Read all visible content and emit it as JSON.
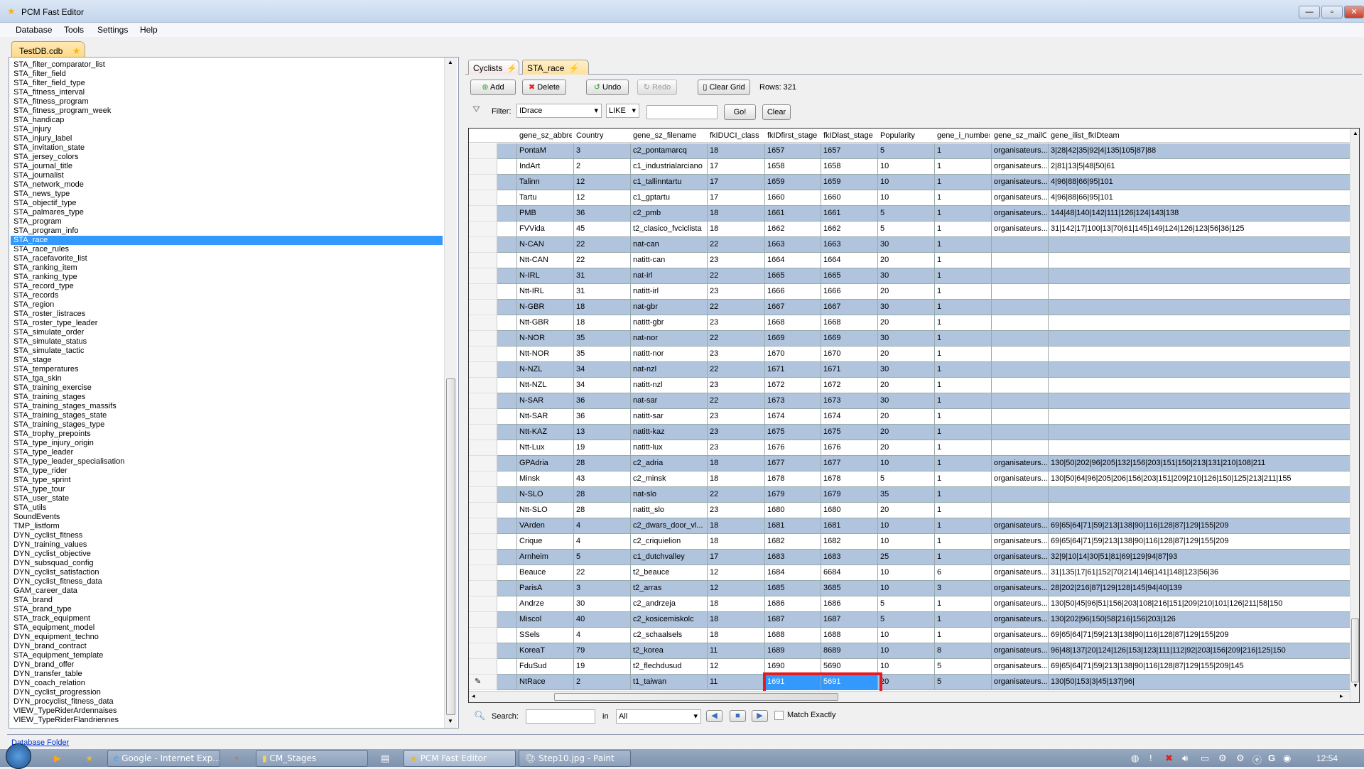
{
  "window": {
    "title": "PCM Fast Editor"
  },
  "menu": [
    "Database",
    "Tools",
    "Settings",
    "Help"
  ],
  "file_tab": "TestDB.cdb",
  "table_list": {
    "selected": "STA_race",
    "items": [
      "STA_filter_comparator_list",
      "STA_filter_field",
      "STA_filter_field_type",
      "STA_fitness_interval",
      "STA_fitness_program",
      "STA_fitness_program_week",
      "STA_handicap",
      "STA_injury",
      "STA_injury_label",
      "STA_invitation_state",
      "STA_jersey_colors",
      "STA_journal_title",
      "STA_journalist",
      "STA_network_mode",
      "STA_news_type",
      "STA_objectif_type",
      "STA_palmares_type",
      "STA_program",
      "STA_program_info",
      "STA_race",
      "STA_race_rules",
      "STA_racefavorite_list",
      "STA_ranking_item",
      "STA_ranking_type",
      "STA_record_type",
      "STA_records",
      "STA_region",
      "STA_roster_listraces",
      "STA_roster_type_leader",
      "STA_simulate_order",
      "STA_simulate_status",
      "STA_simulate_tactic",
      "STA_stage",
      "STA_temperatures",
      "STA_tga_skin",
      "STA_training_exercise",
      "STA_training_stages",
      "STA_training_stages_massifs",
      "STA_training_stages_state",
      "STA_training_stages_type",
      "STA_trophy_prepoints",
      "STA_type_injury_origin",
      "STA_type_leader",
      "STA_type_leader_specialisation",
      "STA_type_rider",
      "STA_type_sprint",
      "STA_type_tour",
      "STA_user_state",
      "STA_utils",
      "SoundEvents",
      "TMP_listform",
      "DYN_cyclist_fitness",
      "DYN_training_values",
      "DYN_cyclist_objective",
      "DYN_subsquad_config",
      "DYN_cyclist_satisfaction",
      "DYN_cyclist_fitness_data",
      "GAM_career_data",
      "STA_brand",
      "STA_brand_type",
      "STA_track_equipment",
      "STA_equipment_model",
      "DYN_equipment_techno",
      "DYN_brand_contract",
      "STA_equipment_template",
      "DYN_brand_offer",
      "DYN_transfer_table",
      "DYN_coach_relation",
      "DYN_cyclist_progression",
      "DYN_procyclist_fitness_data",
      "VIEW_TypeRiderArdennaises",
      "VIEW_TypeRiderFlandriennes"
    ]
  },
  "database_folder_link": "Database Folder",
  "editor_tabs": [
    {
      "label": "Cyclists"
    },
    {
      "label": "STA_race",
      "active": true
    }
  ],
  "toolbar": {
    "add": "Add",
    "delete": "Delete",
    "undo": "Undo",
    "redo": "Redo",
    "clear_grid": "Clear Grid",
    "rows": "Rows: 321"
  },
  "filter": {
    "label": "Filter:",
    "field": "IDrace",
    "operator": "LIKE",
    "value": "",
    "go": "Go!",
    "clear": "Clear"
  },
  "grid": {
    "columns": [
      "gene_sz_abbre",
      "Country",
      "gene_sz_filename",
      "fkIDUCI_class",
      "fkIDfirst_stage",
      "fkIDlast_stage",
      "Popularity",
      "gene_i_number",
      "gene_sz_mailO",
      "gene_ilist_fkIDteam"
    ],
    "rows": [
      [
        "PontaM",
        "3",
        "c2_pontamarcq",
        "18",
        "1657",
        "1657",
        "5",
        "1",
        "organisateurs...",
        "3|28|42|35|92|4|135|105|87|88"
      ],
      [
        "IndArt",
        "2",
        "c1_industrialarciano",
        "17",
        "1658",
        "1658",
        "10",
        "1",
        "organisateurs...",
        "2|81|13|5|48|50|61"
      ],
      [
        "Talinn",
        "12",
        "c1_tallinntartu",
        "17",
        "1659",
        "1659",
        "10",
        "1",
        "organisateurs...",
        "4|96|88|66|95|101"
      ],
      [
        "Tartu",
        "12",
        "c1_gptartu",
        "17",
        "1660",
        "1660",
        "10",
        "1",
        "organisateurs...",
        "4|96|88|66|95|101"
      ],
      [
        "PMB",
        "36",
        "c2_pmb",
        "18",
        "1661",
        "1661",
        "5",
        "1",
        "organisateurs...",
        "144|48|140|142|111|126|124|143|138"
      ],
      [
        "FVVida",
        "45",
        "t2_clasico_fvciclista",
        "18",
        "1662",
        "1662",
        "5",
        "1",
        "organisateurs...",
        "31|142|17|100|13|70|61|145|149|124|126|123|56|36|125"
      ],
      [
        "N-CAN",
        "22",
        "nat-can",
        "22",
        "1663",
        "1663",
        "30",
        "1",
        "",
        ""
      ],
      [
        "Ntt-CAN",
        "22",
        "natitt-can",
        "23",
        "1664",
        "1664",
        "20",
        "1",
        "",
        ""
      ],
      [
        "N-IRL",
        "31",
        "nat-irl",
        "22",
        "1665",
        "1665",
        "30",
        "1",
        "",
        ""
      ],
      [
        "Ntt-IRL",
        "31",
        "natitt-irl",
        "23",
        "1666",
        "1666",
        "20",
        "1",
        "",
        ""
      ],
      [
        "N-GBR",
        "18",
        "nat-gbr",
        "22",
        "1667",
        "1667",
        "30",
        "1",
        "",
        ""
      ],
      [
        "Ntt-GBR",
        "18",
        "natitt-gbr",
        "23",
        "1668",
        "1668",
        "20",
        "1",
        "",
        ""
      ],
      [
        "N-NOR",
        "35",
        "nat-nor",
        "22",
        "1669",
        "1669",
        "30",
        "1",
        "",
        ""
      ],
      [
        "Ntt-NOR",
        "35",
        "natitt-nor",
        "23",
        "1670",
        "1670",
        "20",
        "1",
        "",
        ""
      ],
      [
        "N-NZL",
        "34",
        "nat-nzl",
        "22",
        "1671",
        "1671",
        "30",
        "1",
        "",
        ""
      ],
      [
        "Ntt-NZL",
        "34",
        "natitt-nzl",
        "23",
        "1672",
        "1672",
        "20",
        "1",
        "",
        ""
      ],
      [
        "N-SAR",
        "36",
        "nat-sar",
        "22",
        "1673",
        "1673",
        "30",
        "1",
        "",
        ""
      ],
      [
        "Ntt-SAR",
        "36",
        "natitt-sar",
        "23",
        "1674",
        "1674",
        "20",
        "1",
        "",
        ""
      ],
      [
        "Ntt-KAZ",
        "13",
        "natitt-kaz",
        "23",
        "1675",
        "1675",
        "20",
        "1",
        "",
        ""
      ],
      [
        "Ntt-Lux",
        "19",
        "natitt-lux",
        "23",
        "1676",
        "1676",
        "20",
        "1",
        "",
        ""
      ],
      [
        "GPAdria",
        "28",
        "c2_adria",
        "18",
        "1677",
        "1677",
        "10",
        "1",
        "organisateurs...",
        "130|50|202|96|205|132|156|203|151|150|213|131|210|108|211"
      ],
      [
        "Minsk",
        "43",
        "c2_minsk",
        "18",
        "1678",
        "1678",
        "5",
        "1",
        "organisateurs...",
        "130|50|64|96|205|206|156|203|151|209|210|126|150|125|213|211|155"
      ],
      [
        "N-SLO",
        "28",
        "nat-slo",
        "22",
        "1679",
        "1679",
        "35",
        "1",
        "",
        ""
      ],
      [
        "Ntt-SLO",
        "28",
        "natitt_slo",
        "23",
        "1680",
        "1680",
        "20",
        "1",
        "",
        ""
      ],
      [
        "VArden",
        "4",
        "c2_dwars_door_vl...",
        "18",
        "1681",
        "1681",
        "10",
        "1",
        "organisateurs...",
        "69|65|64|71|59|213|138|90|116|128|87|129|155|209"
      ],
      [
        "Crique",
        "4",
        "c2_criquielion",
        "18",
        "1682",
        "1682",
        "10",
        "1",
        "organisateurs...",
        "69|65|64|71|59|213|138|90|116|128|87|129|155|209"
      ],
      [
        "Arnheim",
        "5",
        "c1_dutchvalley",
        "17",
        "1683",
        "1683",
        "25",
        "1",
        "organisateurs...",
        "32|9|10|14|30|51|81|69|129|94|87|93"
      ],
      [
        "Beauce",
        "22",
        "t2_beauce",
        "12",
        "1684",
        "6684",
        "10",
        "6",
        "organisateurs...",
        "31|135|17|61|152|70|214|146|141|148|123|56|36"
      ],
      [
        "ParisA",
        "3",
        "t2_arras",
        "12",
        "1685",
        "3685",
        "10",
        "3",
        "organisateurs...",
        "28|202|216|87|129|128|145|94|40|139"
      ],
      [
        "Andrze",
        "30",
        "c2_andrzeja",
        "18",
        "1686",
        "1686",
        "5",
        "1",
        "organisateurs...",
        "130|50|45|96|51|156|203|108|216|151|209|210|101|126|211|58|150"
      ],
      [
        "Miscol",
        "40",
        "c2_kosicemiskolc",
        "18",
        "1687",
        "1687",
        "5",
        "1",
        "organisateurs...",
        "130|202|96|150|58|216|156|203|126"
      ],
      [
        "SSels",
        "4",
        "c2_schaalsels",
        "18",
        "1688",
        "1688",
        "10",
        "1",
        "organisateurs...",
        "69|65|64|71|59|213|138|90|116|128|87|129|155|209"
      ],
      [
        "KoreaT",
        "79",
        "t2_korea",
        "11",
        "1689",
        "8689",
        "10",
        "8",
        "organisateurs...",
        "96|48|137|20|124|126|153|123|111|112|92|203|156|209|216|125|150"
      ],
      [
        "FduSud",
        "19",
        "t2_flechdusud",
        "12",
        "1690",
        "5690",
        "10",
        "5",
        "organisateurs...",
        "69|65|64|71|59|213|138|90|116|128|87|129|155|209|145"
      ],
      [
        "NtRace",
        "2",
        "t1_taiwan",
        "11",
        "1691",
        "5691",
        "20",
        "5",
        "organisateurs...",
        "130|50|153|3|45|137|96|"
      ]
    ],
    "editing_row": 34,
    "selected_cells": [
      [
        34,
        4
      ],
      [
        34,
        5
      ]
    ],
    "highlight_color": "#e31b23",
    "row_alt_color": "#b0c4de",
    "selection_color": "#3399ff"
  },
  "search": {
    "label": "Search:",
    "value": "",
    "in_label": "in",
    "scope": "All",
    "match_exactly": "Match Exactly",
    "match_exactly_checked": false
  },
  "taskbar": {
    "items": [
      "Google - Internet Exp...",
      "CM_Stages",
      "PCM Fast Editor",
      "Step10.jpg - Paint"
    ],
    "clock": "12:54"
  }
}
